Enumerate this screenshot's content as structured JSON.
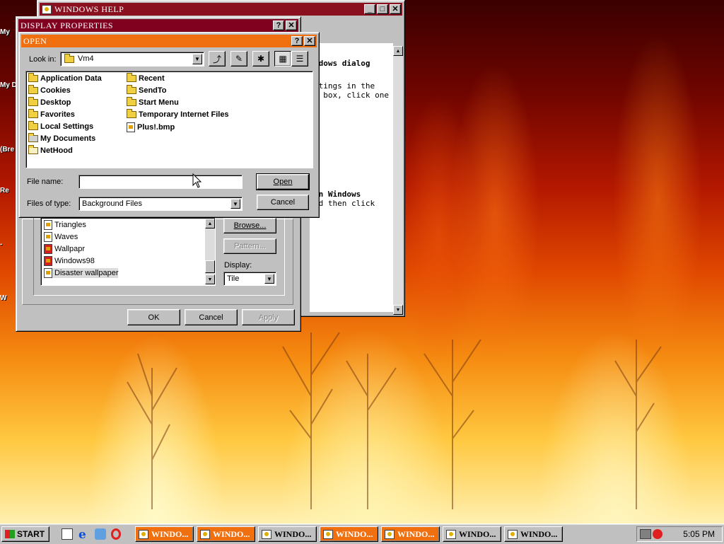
{
  "desktop_labels": [
    "My",
    "My D",
    "(Bre",
    "Re",
    "-",
    "W"
  ],
  "help_window": {
    "title": "Windows Help",
    "text_lines": [
      "ndows dialog",
      "ttings in the",
      "g box, click one",
      "wn Windows",
      "nd then click"
    ]
  },
  "display_properties": {
    "title": "Display Properties",
    "wallpaper_list": [
      "Triangles",
      "Waves",
      "Wallpapr",
      "Windows98",
      "Disaster wallpaper"
    ],
    "selected_wallpaper": "Disaster wallpaper",
    "browse_label": "Browse...",
    "pattern_label": "Pattern...",
    "display_label": "Display:",
    "display_value": "Tile",
    "ok_label": "OK",
    "cancel_label": "Cancel",
    "apply_label": "Apply"
  },
  "open_dialog": {
    "title": "Open",
    "look_in_label": "Look in:",
    "look_in_value": "Vm4",
    "files_col1": [
      "Application Data",
      "Cookies",
      "Desktop",
      "Favorites",
      "Local Settings",
      "My Documents",
      "NetHood"
    ],
    "files_col2": [
      "Recent",
      "SendTo",
      "Start Menu",
      "Temporary Internet Files",
      "Plus!.bmp"
    ],
    "file_name_label": "File name:",
    "file_name_value": "",
    "files_of_type_label": "Files of type:",
    "files_of_type_value": "Background Files",
    "open_label": "Open",
    "cancel_label": "Cancel"
  },
  "taskbar": {
    "start_label": "Start",
    "tasks": [
      "Windo...",
      "Windo...",
      "Windo...",
      "Windo...",
      "Windo...",
      "Windo...",
      "Windo..."
    ],
    "clock": "5:05 PM"
  },
  "colors": {
    "titlebar_active": "#f07010",
    "titlebar_inactive": "#800020",
    "help_titlebar": "#8a1020"
  }
}
